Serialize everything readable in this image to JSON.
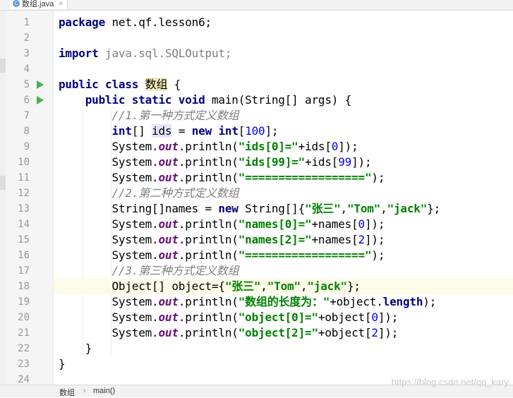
{
  "tab": {
    "filename": "数组.java",
    "icon": "class-icon",
    "close": "×"
  },
  "code": {
    "lines": [
      {
        "n": "1",
        "tokens": [
          {
            "t": "kw",
            "v": "package"
          },
          {
            "t": "",
            "v": " net.qf.lesson6;"
          }
        ]
      },
      {
        "n": "2",
        "tokens": []
      },
      {
        "n": "3",
        "tokens": [
          {
            "t": "kw",
            "v": "import"
          },
          {
            "t": "imp",
            "v": " java.sql.SQLOutput;"
          }
        ]
      },
      {
        "n": "4",
        "tokens": []
      },
      {
        "n": "5",
        "run": true,
        "tokens": [
          {
            "t": "kw",
            "v": "public class "
          },
          {
            "t": "cls",
            "v": "数组"
          },
          {
            "t": "",
            "v": " {"
          }
        ]
      },
      {
        "n": "6",
        "run": true,
        "fold": true,
        "tokens": [
          {
            "t": "",
            "v": "    "
          },
          {
            "t": "kw",
            "v": "public static void"
          },
          {
            "t": "",
            "v": " main(String[] args) {"
          }
        ]
      },
      {
        "n": "7",
        "tokens": [
          {
            "t": "",
            "v": "        "
          },
          {
            "t": "cmt",
            "v": "//1.第一种方式定义数组"
          }
        ]
      },
      {
        "n": "8",
        "tokens": [
          {
            "t": "",
            "v": "        "
          },
          {
            "t": "kw",
            "v": "int"
          },
          {
            "t": "",
            "v": "[] "
          },
          {
            "t": "vhl",
            "v": "ids"
          },
          {
            "t": "",
            "v": " = "
          },
          {
            "t": "kw",
            "v": "new int"
          },
          {
            "t": "",
            "v": "["
          },
          {
            "t": "num",
            "v": "100"
          },
          {
            "t": "",
            "v": "];"
          }
        ]
      },
      {
        "n": "9",
        "tokens": [
          {
            "t": "",
            "v": "        System."
          },
          {
            "t": "fld",
            "v": "out"
          },
          {
            "t": "",
            "v": ".println("
          },
          {
            "t": "str",
            "v": "\"ids[0]=\""
          },
          {
            "t": "",
            "v": "+ids["
          },
          {
            "t": "num",
            "v": "0"
          },
          {
            "t": "",
            "v": "]);"
          }
        ]
      },
      {
        "n": "10",
        "tokens": [
          {
            "t": "",
            "v": "        System."
          },
          {
            "t": "fld",
            "v": "out"
          },
          {
            "t": "",
            "v": ".println("
          },
          {
            "t": "str",
            "v": "\"ids[99]=\""
          },
          {
            "t": "",
            "v": "+ids["
          },
          {
            "t": "num",
            "v": "99"
          },
          {
            "t": "",
            "v": "]);"
          }
        ]
      },
      {
        "n": "11",
        "tokens": [
          {
            "t": "",
            "v": "        System."
          },
          {
            "t": "fld",
            "v": "out"
          },
          {
            "t": "",
            "v": ".println("
          },
          {
            "t": "str",
            "v": "\"==================\""
          },
          {
            "t": "",
            "v": ");"
          }
        ]
      },
      {
        "n": "12",
        "tokens": [
          {
            "t": "",
            "v": "        "
          },
          {
            "t": "cmt",
            "v": "//2.第二种方式定义数组"
          }
        ]
      },
      {
        "n": "13",
        "tokens": [
          {
            "t": "",
            "v": "        String[]names = "
          },
          {
            "t": "kw",
            "v": "new"
          },
          {
            "t": "",
            "v": " String[]{"
          },
          {
            "t": "str",
            "v": "\"张三\""
          },
          {
            "t": "",
            "v": ","
          },
          {
            "t": "str",
            "v": "\"Tom\""
          },
          {
            "t": "",
            "v": ","
          },
          {
            "t": "str",
            "v": "\"jack\""
          },
          {
            "t": "",
            "v": "};"
          }
        ]
      },
      {
        "n": "14",
        "tokens": [
          {
            "t": "",
            "v": "        System."
          },
          {
            "t": "fld",
            "v": "out"
          },
          {
            "t": "",
            "v": ".println("
          },
          {
            "t": "str",
            "v": "\"names[0]=\""
          },
          {
            "t": "",
            "v": "+names["
          },
          {
            "t": "num",
            "v": "0"
          },
          {
            "t": "",
            "v": "]);"
          }
        ]
      },
      {
        "n": "15",
        "tokens": [
          {
            "t": "",
            "v": "        System."
          },
          {
            "t": "fld",
            "v": "out"
          },
          {
            "t": "",
            "v": ".println("
          },
          {
            "t": "str",
            "v": "\"names[2]=\""
          },
          {
            "t": "",
            "v": "+names["
          },
          {
            "t": "num",
            "v": "2"
          },
          {
            "t": "",
            "v": "]);"
          }
        ]
      },
      {
        "n": "16",
        "tokens": [
          {
            "t": "",
            "v": "        System."
          },
          {
            "t": "fld",
            "v": "out"
          },
          {
            "t": "",
            "v": ".println("
          },
          {
            "t": "str",
            "v": "\"==================\""
          },
          {
            "t": "",
            "v": ");"
          }
        ]
      },
      {
        "n": "17",
        "tokens": [
          {
            "t": "",
            "v": "        "
          },
          {
            "t": "cmt",
            "v": "//3.第三种方式定义数组"
          }
        ]
      },
      {
        "n": "18",
        "current": true,
        "tokens": [
          {
            "t": "",
            "v": "        Object[] object={"
          },
          {
            "t": "str",
            "v": "\"张三\""
          },
          {
            "t": "",
            "v": ","
          },
          {
            "t": "str",
            "v": "\"Tom\""
          },
          {
            "t": "",
            "v": ","
          },
          {
            "t": "str",
            "v": "\"jack\""
          },
          {
            "t": "",
            "v": "};"
          }
        ]
      },
      {
        "n": "19",
        "tokens": [
          {
            "t": "",
            "v": "        System."
          },
          {
            "t": "fld",
            "v": "out"
          },
          {
            "t": "",
            "v": ".println("
          },
          {
            "t": "str",
            "v": "\"数组的长度为：\""
          },
          {
            "t": "",
            "v": "+object."
          },
          {
            "t": "kw",
            "v": "length"
          },
          {
            "t": "",
            "v": ");"
          }
        ]
      },
      {
        "n": "20",
        "tokens": [
          {
            "t": "",
            "v": "        System."
          },
          {
            "t": "fld",
            "v": "out"
          },
          {
            "t": "",
            "v": ".println("
          },
          {
            "t": "str",
            "v": "\"object[0]=\""
          },
          {
            "t": "",
            "v": "+object["
          },
          {
            "t": "num",
            "v": "0"
          },
          {
            "t": "",
            "v": "]);"
          }
        ]
      },
      {
        "n": "21",
        "tokens": [
          {
            "t": "",
            "v": "        System."
          },
          {
            "t": "fld",
            "v": "out"
          },
          {
            "t": "",
            "v": ".println("
          },
          {
            "t": "str",
            "v": "\"object[2]=\""
          },
          {
            "t": "",
            "v": "+object["
          },
          {
            "t": "num",
            "v": "2"
          },
          {
            "t": "",
            "v": "]);"
          }
        ]
      },
      {
        "n": "22",
        "fold": true,
        "tokens": [
          {
            "t": "",
            "v": "    }"
          }
        ]
      },
      {
        "n": "23",
        "tokens": [
          {
            "t": "",
            "v": "}"
          }
        ]
      },
      {
        "n": "24",
        "tokens": []
      }
    ]
  },
  "status": {
    "breadcrumb": [
      "数组",
      "main()"
    ],
    "separator": "›"
  },
  "watermark": "https://blog.csdn.net/qq_kary",
  "colors": {
    "keyword": "#000080",
    "string": "#008000",
    "number": "#0000ff",
    "comment": "#808080",
    "field": "#660e7a",
    "run": "#4caf50"
  }
}
